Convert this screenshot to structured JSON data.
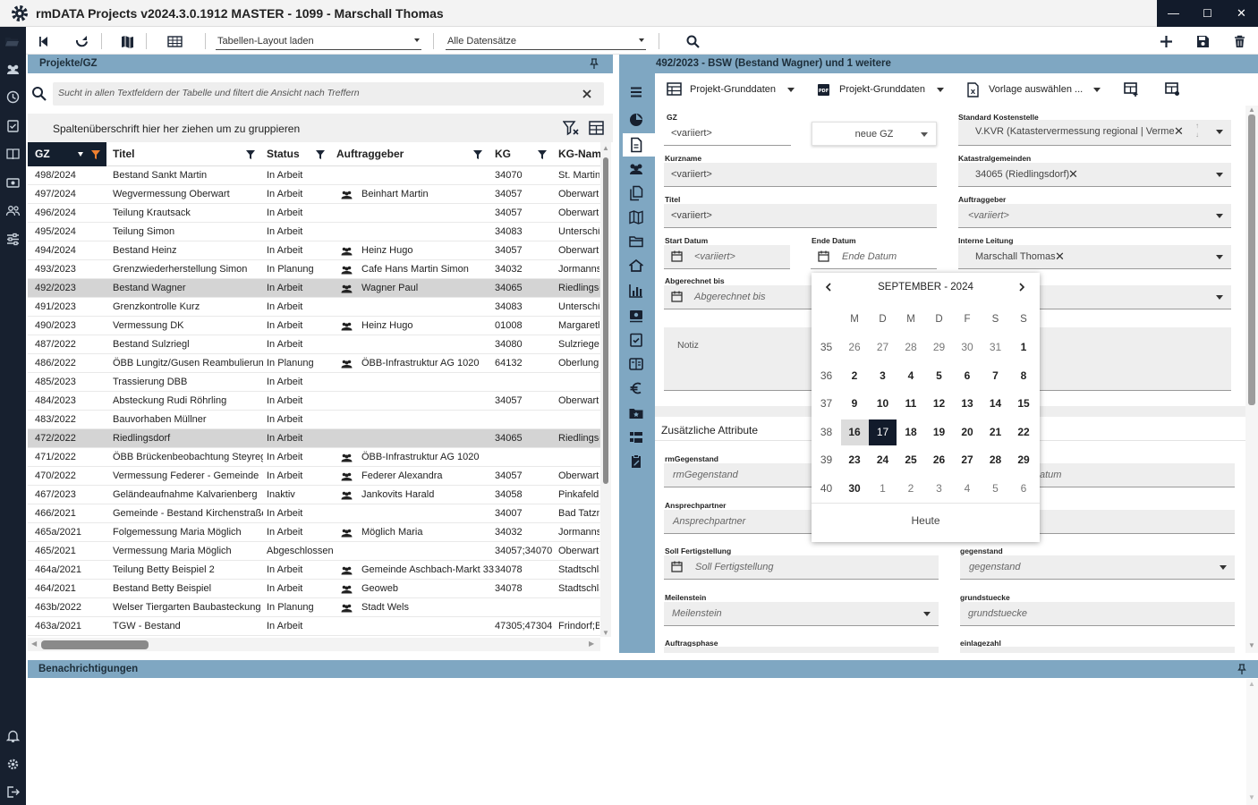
{
  "window": {
    "title": "rmDATA Projects v2024.3.0.1912 MASTER - 1099 - Marschall Thomas",
    "minimize": "—",
    "maximize": "☐",
    "close": "✕"
  },
  "toolbar": {
    "layout_select": "Tabellen-Layout laden",
    "dataset_select": "Alle Datensätze"
  },
  "left_panel": {
    "title": "Projekte/GZ",
    "search_placeholder": "Sucht in allen Textfeldern der Tabelle und filtert die Ansicht nach Treffern",
    "group_hint": "Spaltenüberschrift hier her ziehen um zu gruppieren",
    "columns": [
      "GZ",
      "Titel",
      "Status",
      "Auftraggeber",
      "KG",
      "KG-Name"
    ],
    "rows": [
      {
        "gz": "498/2024",
        "titel": "Bestand Sankt Martin",
        "status": "In Arbeit",
        "auftraggeber": "",
        "kg": "34070",
        "kgname": "St. Martin",
        "sel": false
      },
      {
        "gz": "497/2024",
        "titel": "Wegvermessung Oberwart",
        "status": "In Arbeit",
        "auftraggeber": "Beinhart Martin",
        "kg": "34057",
        "kgname": "Oberwart",
        "sel": false
      },
      {
        "gz": "496/2024",
        "titel": "Teilung Krautsack",
        "status": "In Arbeit",
        "auftraggeber": "",
        "kg": "34057",
        "kgname": "Oberwart",
        "sel": false
      },
      {
        "gz": "495/2024",
        "titel": "Teilung Simon",
        "status": "In Arbeit",
        "auftraggeber": "",
        "kg": "34083",
        "kgname": "Unterschü",
        "sel": false
      },
      {
        "gz": "494/2024",
        "titel": "Bestand Heinz",
        "status": "In Arbeit",
        "auftraggeber": "Heinz Hugo",
        "kg": "34057",
        "kgname": "Oberwart",
        "sel": false
      },
      {
        "gz": "493/2023",
        "titel": "Grenzwiederherstellung Simon",
        "status": "In Planung",
        "auftraggeber": "Cafe Hans Martin Simon",
        "kg": "34032",
        "kgname": "Jormanns",
        "sel": false
      },
      {
        "gz": "492/2023",
        "titel": "Bestand Wagner",
        "status": "In Arbeit",
        "auftraggeber": "Wagner Paul",
        "kg": "34065",
        "kgname": "Riedlingsc",
        "sel": true
      },
      {
        "gz": "491/2023",
        "titel": "Grenzkontrolle Kurz",
        "status": "In Arbeit",
        "auftraggeber": "",
        "kg": "34083",
        "kgname": "Unterschü",
        "sel": false
      },
      {
        "gz": "490/2023",
        "titel": "Vermessung DK",
        "status": "In Arbeit",
        "auftraggeber": "Heinz Hugo",
        "kg": "01008",
        "kgname": "Margareth",
        "sel": false
      },
      {
        "gz": "487/2022",
        "titel": "Bestand Sulzriegl",
        "status": "In Arbeit",
        "auftraggeber": "",
        "kg": "34080",
        "kgname": "Sulzriegel",
        "sel": false
      },
      {
        "gz": "486/2022",
        "titel": "ÖBB Lungitz/Gusen Reambulierung",
        "status": "In Planung",
        "auftraggeber": "ÖBB-Infrastruktur AG 1020",
        "kg": "64132",
        "kgname": "Oberlungi",
        "sel": false
      },
      {
        "gz": "485/2023",
        "titel": "Trassierung DBB",
        "status": "In Arbeit",
        "auftraggeber": "",
        "kg": "",
        "kgname": "",
        "sel": false
      },
      {
        "gz": "484/2023",
        "titel": "Absteckung Rudi Röhrling",
        "status": "In Arbeit",
        "auftraggeber": "",
        "kg": "34057",
        "kgname": "Oberwart",
        "sel": false
      },
      {
        "gz": "483/2022",
        "titel": "Bauvorhaben Müllner",
        "status": "In Arbeit",
        "auftraggeber": "",
        "kg": "",
        "kgname": "",
        "sel": false
      },
      {
        "gz": "472/2022",
        "titel": "Riedlingsdorf",
        "status": "In Arbeit",
        "auftraggeber": "",
        "kg": "34065",
        "kgname": "Riedlingsc",
        "sel": true
      },
      {
        "gz": "471/2022",
        "titel": "ÖBB Brückenbeobachtung Steyregg",
        "status": "In Arbeit",
        "auftraggeber": "ÖBB-Infrastruktur AG 1020",
        "kg": "",
        "kgname": "",
        "sel": false
      },
      {
        "gz": "470/2022",
        "titel": "Vermessung Federer - Gemeinde",
        "status": "In Arbeit",
        "auftraggeber": "Federer Alexandra",
        "kg": "34057",
        "kgname": "Oberwart",
        "sel": false
      },
      {
        "gz": "467/2023",
        "titel": "Geländeaufnahme Kalvarienberg",
        "status": "Inaktiv",
        "auftraggeber": "Jankovits Harald",
        "kg": "34058",
        "kgname": "Pinkafeld",
        "sel": false
      },
      {
        "gz": "466/2021",
        "titel": "Gemeinde - Bestand Kirchenstraße",
        "status": "In Arbeit",
        "auftraggeber": "",
        "kg": "34007",
        "kgname": "Bad Tatzm",
        "sel": false
      },
      {
        "gz": "465a/2021",
        "titel": "Folgemessung Maria Möglich",
        "status": "In Arbeit",
        "auftraggeber": "Möglich Maria",
        "kg": "34032",
        "kgname": "Jormanns",
        "sel": false
      },
      {
        "gz": "465/2021",
        "titel": "Vermessung Maria Möglich",
        "status": "Abgeschlossen",
        "auftraggeber": "",
        "kg": "34057;34070",
        "kgname": "Oberwart,",
        "sel": false
      },
      {
        "gz": "464a/2021",
        "titel": "Teilung Betty Beispiel 2",
        "status": "In Arbeit",
        "auftraggeber": "Gemeinde Aschbach-Markt 33",
        "kg": "34078",
        "kgname": "Stadtschla",
        "sel": false
      },
      {
        "gz": "464/2021",
        "titel": "Bestand Betty Beispiel",
        "status": "In Arbeit",
        "auftraggeber": "Geoweb",
        "kg": "34078",
        "kgname": "Stadtschla",
        "sel": false
      },
      {
        "gz": "463b/2022",
        "titel": "Welser Tiergarten Baubasteckung",
        "status": "In Planung",
        "auftraggeber": "Stadt Wels",
        "kg": "",
        "kgname": "",
        "sel": false
      },
      {
        "gz": "463a/2021",
        "titel": "TGW - Bestand",
        "status": "In Arbeit",
        "auftraggeber": "",
        "kg": "47305;47304",
        "kgname": "Frindorf;B",
        "sel": false
      }
    ]
  },
  "right_panel": {
    "title": "492/2023 - BSW (Bestand Wagner) und 1 weitere",
    "toolbar": {
      "grunddaten1": "Projekt-Grunddaten",
      "grunddaten2": "Projekt-Grunddaten",
      "vorlage": "Vorlage auswählen ..."
    },
    "form": {
      "gz_label": "GZ",
      "gz_value": "<variiert>",
      "neue_gz": "neue GZ",
      "kostenstelle_label": "Standard Kostenstelle",
      "kostenstelle_value": "V.KVR (Katastervermessung regional | Vermessu",
      "kurzname_label": "Kurzname",
      "kurzname_value": "<variiert>",
      "katastral_label": "Katastralgemeinden",
      "katastral_value": "34065 (Riedlingsdorf)",
      "titel_label": "Titel",
      "titel_value": "<variiert>",
      "auftraggeber_label": "Auftraggeber",
      "auftraggeber_value": "<variiert>",
      "start_label": "Start Datum",
      "start_value": "<variiert>",
      "ende_label": "Ende Datum",
      "ende_placeholder": "Ende Datum",
      "leitung_label": "Interne Leitung",
      "leitung_value": "Marschall Thomas",
      "abgerechnet_label": "Abgerechnet bis",
      "abgerechnet_placeholder": "Abgerechnet bis",
      "notiz_label": "Notiz",
      "zusatz_title": "Zusätzliche Attribute",
      "rmgegenstand_label": "rmGegenstand",
      "rmgegenstand_placeholder": "rmGegenstand",
      "datum_partial": "atum",
      "ansprech_label": "Ansprechpartner",
      "ansprech_placeholder": "Ansprechpartner",
      "sollfertig_label": "Soll Fertigstellung",
      "sollfertig_placeholder": "Soll Fertigstellung",
      "gegenstand_label": "gegenstand",
      "gegenstand_placeholder": "gegenstand",
      "meilenstein_label": "Meilenstein",
      "meilenstein_placeholder": "Meilenstein",
      "grundstuecke_label": "grundstuecke",
      "grundstuecke_placeholder": "grundstuecke",
      "auftragsphase_label": "Auftragsphase",
      "einlagezahl_label": "einlagezahl"
    }
  },
  "calendar": {
    "month": "SEPTEMBER - 2024",
    "weekdays": [
      "M",
      "D",
      "M",
      "D",
      "F",
      "S",
      "S"
    ],
    "today_label": "Heute",
    "weeks": [
      {
        "wk": "35",
        "days": [
          "26",
          "27",
          "28",
          "29",
          "30",
          "31",
          "1"
        ]
      },
      {
        "wk": "36",
        "days": [
          "2",
          "3",
          "4",
          "5",
          "6",
          "7",
          "8"
        ]
      },
      {
        "wk": "37",
        "days": [
          "9",
          "10",
          "11",
          "12",
          "13",
          "14",
          "15"
        ]
      },
      {
        "wk": "38",
        "days": [
          "16",
          "17",
          "18",
          "19",
          "20",
          "21",
          "22"
        ]
      },
      {
        "wk": "39",
        "days": [
          "23",
          "24",
          "25",
          "26",
          "27",
          "28",
          "29"
        ]
      },
      {
        "wk": "40",
        "days": [
          "30",
          "1",
          "2",
          "3",
          "4",
          "5",
          "6"
        ]
      }
    ],
    "highlighted": "16",
    "selected": "17"
  },
  "notifications": {
    "title": "Benachrichtigungen"
  },
  "colors": {
    "panel_header": "#7fa7c2",
    "rail": "#17202f",
    "selected": "#121b2b"
  }
}
